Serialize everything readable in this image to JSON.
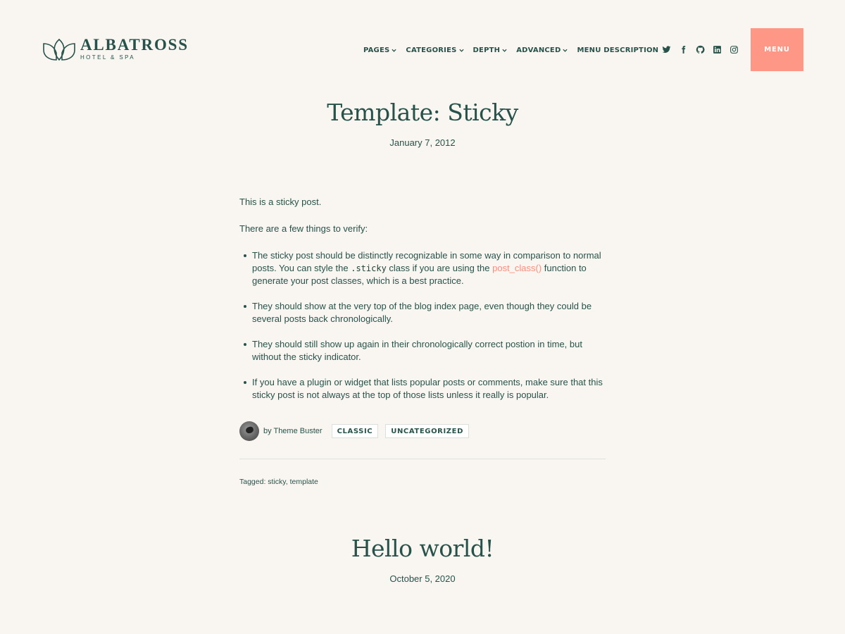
{
  "site": {
    "name": "ALBATROSS",
    "tagline": "HOTEL & SPA"
  },
  "nav": {
    "items": [
      {
        "label": "PAGES",
        "has_dropdown": true
      },
      {
        "label": "CATEGORIES",
        "has_dropdown": true
      },
      {
        "label": "DEPTH",
        "has_dropdown": true
      },
      {
        "label": "ADVANCED",
        "has_dropdown": true
      },
      {
        "label": "MENU DESCRIPTION",
        "has_dropdown": false
      }
    ],
    "menu_button": "MENU"
  },
  "social_icons": [
    "twitter-icon",
    "facebook-icon",
    "github-icon",
    "linkedin-icon",
    "instagram-icon"
  ],
  "colors": {
    "background": "#f9f6f2",
    "text": "#27524a",
    "accent": "#ff9786",
    "link": "#ff8b7a"
  },
  "posts": [
    {
      "title": "Template: Sticky",
      "date": "January 7, 2012",
      "intro": "This is a sticky post.",
      "lead": "There are a few things to verify:",
      "bullets": [
        {
          "before": "The sticky post should be distinctly recognizable in some way in comparison to normal posts. You can style the ",
          "code": ".sticky",
          "middle": " class if you are using the ",
          "link": "post_class()",
          "after": " function to generate your post classes, which is a best practice."
        },
        {
          "text": "They should show at the very top of the blog index page, even though they could be several posts back chronologically."
        },
        {
          "text": "They should still show up again in their chronologically correct postion in time, but without the sticky indicator."
        },
        {
          "text": "If you have a plugin or widget that lists popular posts or comments, make sure that this sticky post is not always at the top of those lists unless it really is popular."
        }
      ],
      "author": "by Theme Buster",
      "categories": [
        "CLASSIC",
        "UNCATEGORIZED"
      ],
      "tagged_label": "Tagged:",
      "tags": [
        "sticky",
        "template"
      ]
    },
    {
      "title": "Hello world!",
      "date": "October 5, 2020"
    }
  ]
}
